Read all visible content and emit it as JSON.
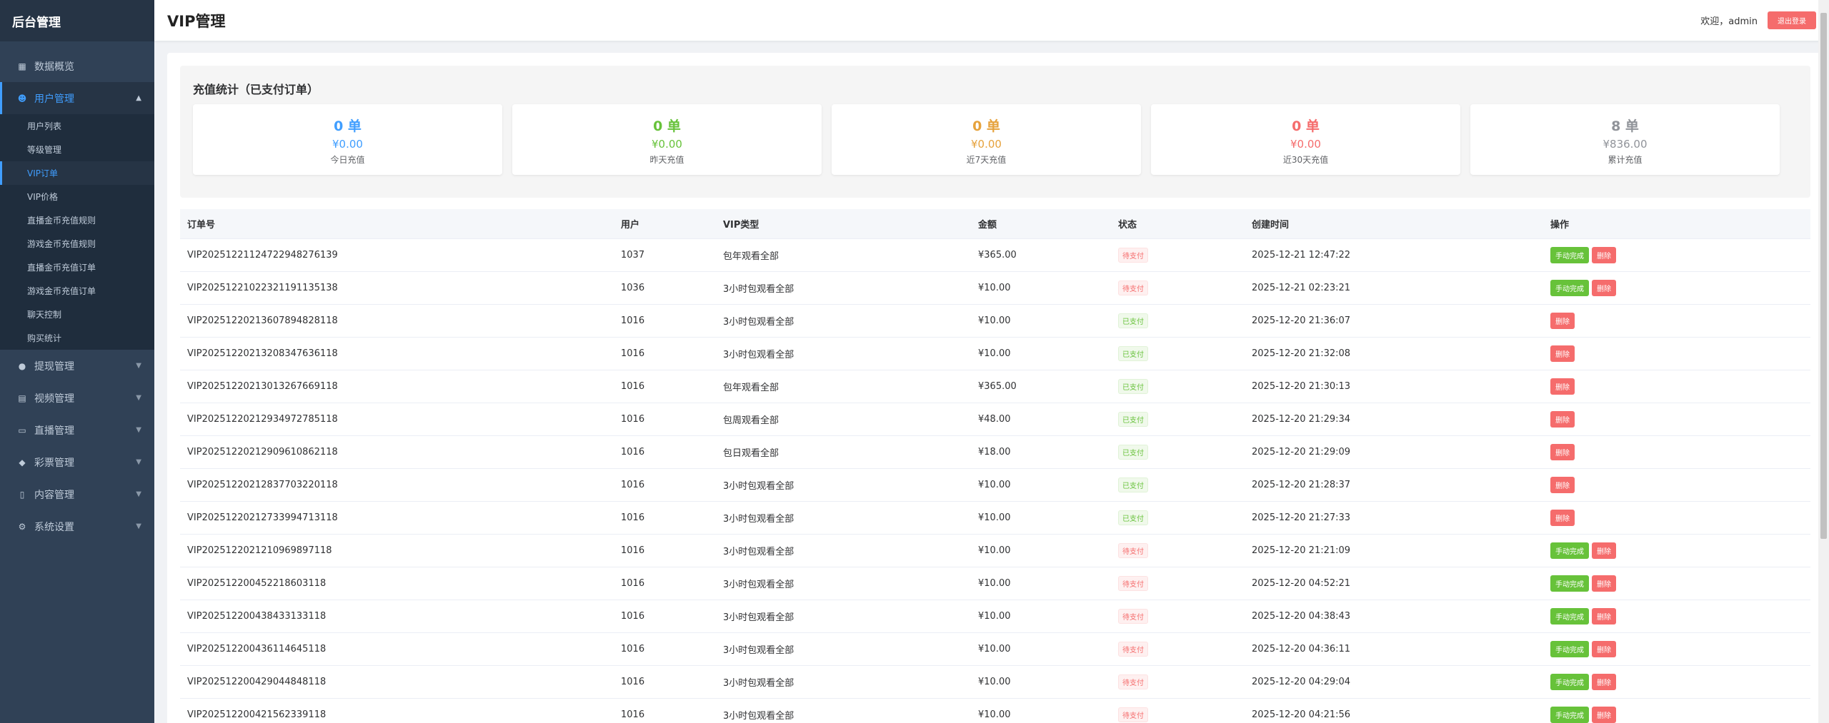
{
  "app": {
    "brand": "后台管理"
  },
  "header": {
    "title": "VIP管理",
    "welcome": "欢迎，admin",
    "logout_label": "退出登录"
  },
  "sidebar": {
    "items": [
      {
        "label": "数据概览",
        "icon": "chart-icon"
      },
      {
        "label": "用户管理",
        "icon": "users-icon",
        "open": true,
        "children": [
          "用户列表",
          "等级管理",
          "VIP订单",
          "VIP价格",
          "直播金币充值规则",
          "游戏金币充值规则",
          "直播金币充值订单",
          "游戏金币充值订单",
          "聊天控制",
          "购买统计"
        ],
        "active_child": "VIP订单"
      },
      {
        "label": "提现管理",
        "icon": "money-bag-icon"
      },
      {
        "label": "视频管理",
        "icon": "film-icon"
      },
      {
        "label": "直播管理",
        "icon": "tv-icon"
      },
      {
        "label": "彩票管理",
        "icon": "package-icon"
      },
      {
        "label": "内容管理",
        "icon": "document-icon"
      },
      {
        "label": "系统设置",
        "icon": "gear-icon"
      }
    ]
  },
  "stats": {
    "title": "充值统计（已支付订单）",
    "cards": [
      {
        "count": "0 单",
        "amount": "¥0.00",
        "label": "今日充值",
        "color": "#409eff"
      },
      {
        "count": "0 单",
        "amount": "¥0.00",
        "label": "昨天充值",
        "color": "#67c23a"
      },
      {
        "count": "0 单",
        "amount": "¥0.00",
        "label": "近7天充值",
        "color": "#e6a23c"
      },
      {
        "count": "0 单",
        "amount": "¥0.00",
        "label": "近30天充值",
        "color": "#f56c6c"
      },
      {
        "count": "8 单",
        "amount": "¥836.00",
        "label": "累计充值",
        "color": "#909399"
      }
    ]
  },
  "table": {
    "headers": [
      "订单号",
      "用户",
      "VIP类型",
      "金额",
      "状态",
      "创建时间",
      "操作"
    ],
    "actions": {
      "complete": "手动完成",
      "delete": "删除"
    },
    "rows": [
      {
        "order": "VIP20251221124722948276139",
        "user": "1037",
        "type": "包年观看全部",
        "amount": "¥365.00",
        "status": "待支付",
        "time": "2025-12-21 12:47:22"
      },
      {
        "order": "VIP20251221022321191135138",
        "user": "1036",
        "type": "3小时包观看全部",
        "amount": "¥10.00",
        "status": "待支付",
        "time": "2025-12-21 02:23:21"
      },
      {
        "order": "VIP20251220213607894828118",
        "user": "1016",
        "type": "3小时包观看全部",
        "amount": "¥10.00",
        "status": "已支付",
        "time": "2025-12-20 21:36:07"
      },
      {
        "order": "VIP20251220213208347636118",
        "user": "1016",
        "type": "3小时包观看全部",
        "amount": "¥10.00",
        "status": "已支付",
        "time": "2025-12-20 21:32:08"
      },
      {
        "order": "VIP20251220213013267669118",
        "user": "1016",
        "type": "包年观看全部",
        "amount": "¥365.00",
        "status": "已支付",
        "time": "2025-12-20 21:30:13"
      },
      {
        "order": "VIP20251220212934972785118",
        "user": "1016",
        "type": "包周观看全部",
        "amount": "¥48.00",
        "status": "已支付",
        "time": "2025-12-20 21:29:34"
      },
      {
        "order": "VIP20251220212909610862118",
        "user": "1016",
        "type": "包日观看全部",
        "amount": "¥18.00",
        "status": "已支付",
        "time": "2025-12-20 21:29:09"
      },
      {
        "order": "VIP20251220212837703220118",
        "user": "1016",
        "type": "3小时包观看全部",
        "amount": "¥10.00",
        "status": "已支付",
        "time": "2025-12-20 21:28:37"
      },
      {
        "order": "VIP20251220212733994713118",
        "user": "1016",
        "type": "3小时包观看全部",
        "amount": "¥10.00",
        "status": "已支付",
        "time": "2025-12-20 21:27:33"
      },
      {
        "order": "VIP2025122021210969897118",
        "user": "1016",
        "type": "3小时包观看全部",
        "amount": "¥10.00",
        "status": "待支付",
        "time": "2025-12-20 21:21:09"
      },
      {
        "order": "VIP20251220045221860311​8",
        "user": "1016",
        "type": "3小时包观看全部",
        "amount": "¥10.00",
        "status": "待支付",
        "time": "2025-12-20 04:52:21"
      },
      {
        "order": "VIP20251220043843313​3118",
        "user": "1016",
        "type": "3小时包观看全部",
        "amount": "¥10.00",
        "status": "待支付",
        "time": "2025-12-20 04:38:43"
      },
      {
        "order": "VIP20251220043611464​5118",
        "user": "1016",
        "type": "3小时包观看全部",
        "amount": "¥10.00",
        "status": "待支付",
        "time": "2025-12-20 04:36:11"
      },
      {
        "order": "VIP20251220042904484​8118",
        "user": "1016",
        "type": "3小时包观看全部",
        "amount": "¥10.00",
        "status": "待支付",
        "time": "2025-12-20 04:29:04"
      },
      {
        "order": "VIP20251220042156233​9118",
        "user": "1016",
        "type": "3小时包观看全部",
        "amount": "¥10.00",
        "status": "待支付",
        "time": "2025-12-20 04:21:56"
      }
    ]
  }
}
